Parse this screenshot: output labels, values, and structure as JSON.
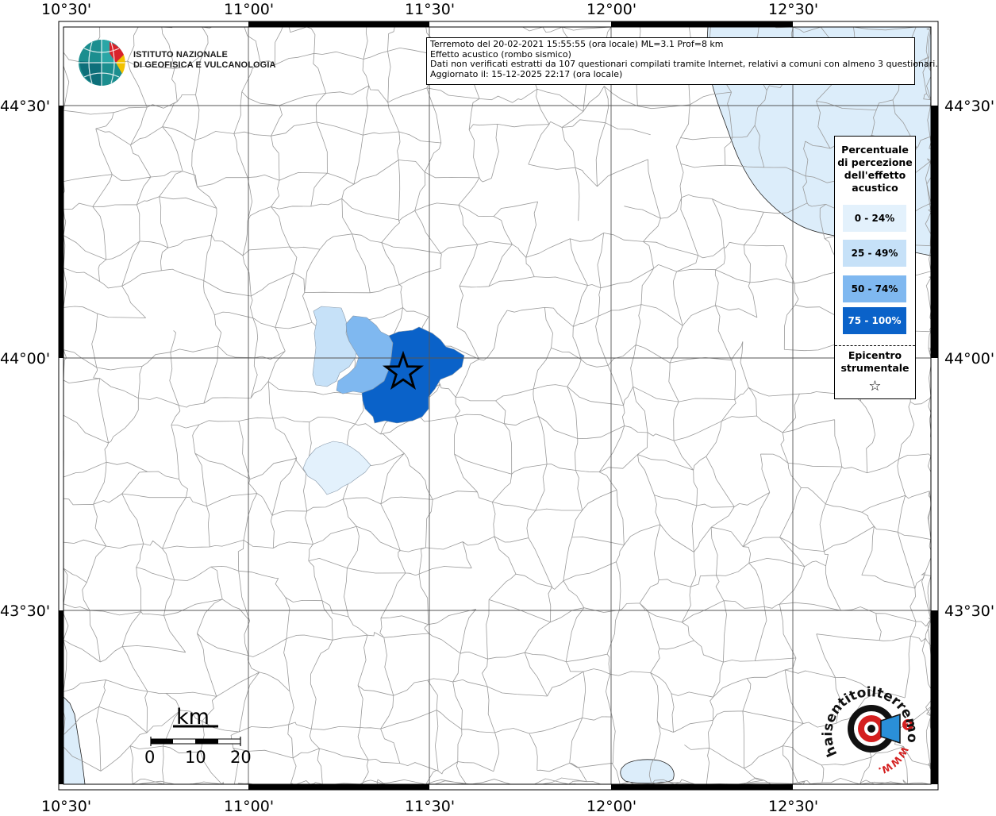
{
  "map": {
    "lon_ticks": [
      "10°30'",
      "11°00'",
      "11°30'",
      "12°00'",
      "12°30'"
    ],
    "lat_ticks": [
      "44°30'",
      "44°00'",
      "43°30'"
    ],
    "colors": {
      "sea": "#dcedfa",
      "class_0_24": "#e3f1fc",
      "class_25_49": "#c6e1f8",
      "class_50_74": "#7fb8f0",
      "class_75_100": "#0a62c9",
      "boundary": "#9a9a9a"
    },
    "epicenter": {
      "lon": 11.44,
      "lat": 43.98,
      "symbol": "star"
    }
  },
  "logo": {
    "ingv_line1": "ISTITUTO NAZIONALE",
    "ingv_line2": "DI GEOFISICA E VULCANOLOGIA",
    "hsit_text": "haisentitoilterremoto.it",
    "hsit_url": "WWW."
  },
  "info": {
    "line1": "Terremoto del 20-02-2021 15:55:55 (ora locale) ML=3.1 Prof=8 km",
    "line2": "Effetto acustico (rombo sismico)",
    "line3": "Dati non verificati estratti da 107 questionari compilati tramite Internet, relativi a comuni con almeno 3 questionari.",
    "line4": "Aggiornato il: 15-12-2025 22:17 (ora locale)"
  },
  "legend": {
    "title": "Percentuale di percezione dell'effetto acustico",
    "classes": [
      {
        "label": "0 - 24%",
        "color": "#e3f1fc",
        "text_color": "#000000"
      },
      {
        "label": "25 - 49%",
        "color": "#c6e1f8",
        "text_color": "#000000"
      },
      {
        "label": "50 - 74%",
        "color": "#7fb8f0",
        "text_color": "#000000"
      },
      {
        "label": "75 - 100%",
        "color": "#0a62c9",
        "text_color": "#ffffff"
      }
    ],
    "epicenter_label": "Epicentro strumentale",
    "epicenter_symbol": "☆"
  },
  "scale_bar": {
    "unit": "km",
    "labels": [
      "0",
      "10",
      "20"
    ]
  }
}
